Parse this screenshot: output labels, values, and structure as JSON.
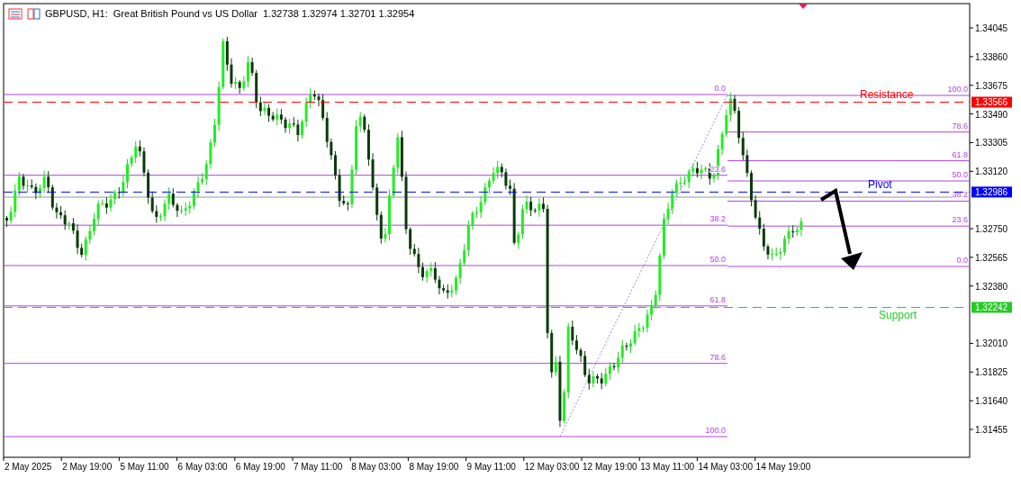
{
  "header": {
    "symbol_line": "GBPUSD, H1:  Great British Pound vs US Dollar  1.32738 1.32974 1.32701 1.32954"
  },
  "price_axis": {
    "ticks": [
      "1.34045",
      "1.33860",
      "1.33675",
      "1.33490",
      "1.33305",
      "1.33120",
      "1.32750",
      "1.32565",
      "1.32380",
      "1.32010",
      "1.31825",
      "1.31640",
      "1.31455"
    ]
  },
  "time_axis": {
    "ticks": [
      "2 May 2025",
      "2 May 19:00",
      "5 May 11:00",
      "6 May 03:00",
      "6 May 19:00",
      "7 May 11:00",
      "8 May 03:00",
      "8 May 19:00",
      "9 May 11:00",
      "12 May 03:00",
      "12 May 19:00",
      "13 May 11:00",
      "14 May 03:00",
      "14 May 19:00"
    ]
  },
  "levels": [
    {
      "label": "Resistance",
      "price": "1.33566",
      "color": "#ff0000"
    },
    {
      "label": "Pivot",
      "price": "1.32986",
      "color": "#0000ff"
    },
    {
      "label": "Support",
      "price": "1.32242",
      "color": "#22cc22"
    }
  ],
  "fibonacci": [
    {
      "levels": [
        "0.0",
        "23.6",
        "38.2",
        "50.0",
        "61.8",
        "78.6",
        "100.0"
      ]
    },
    {
      "levels": [
        "100.0",
        "78.6",
        "61.8",
        "50.0",
        "38.2",
        "23.6",
        "0.0"
      ]
    }
  ]
}
